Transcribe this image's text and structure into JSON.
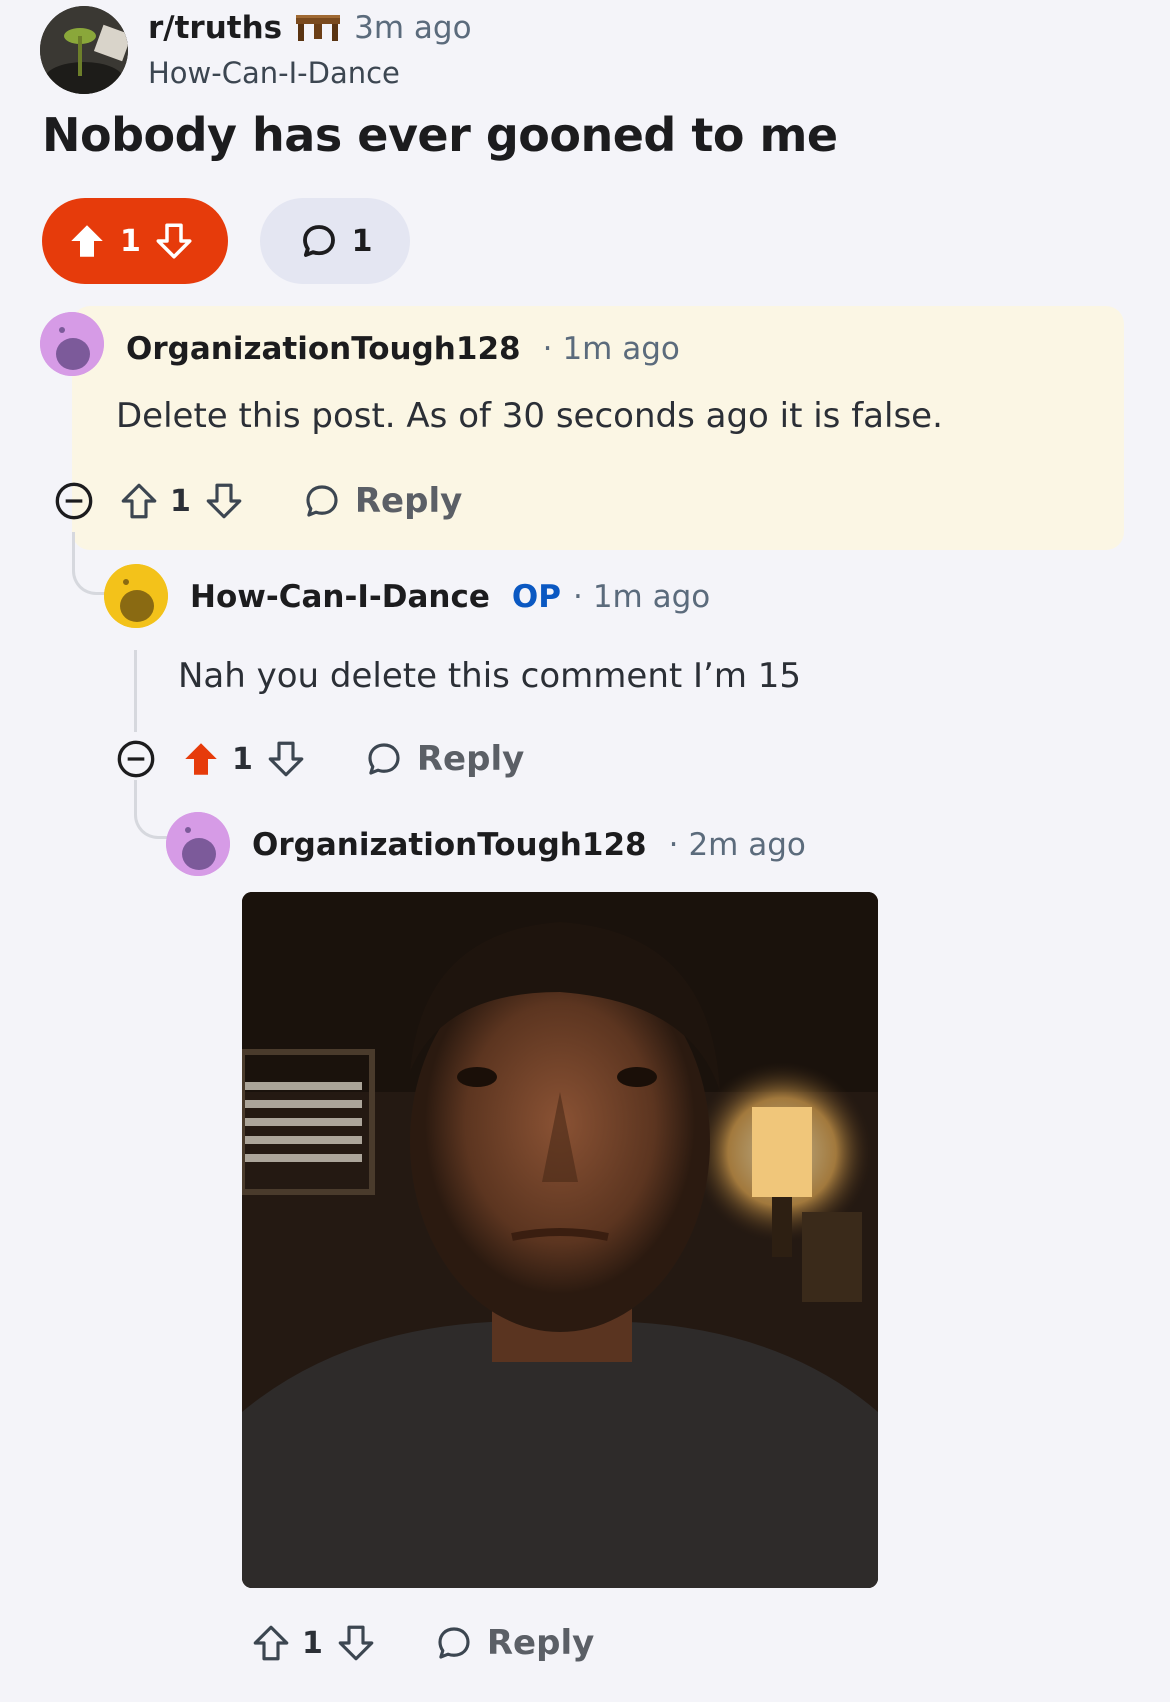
{
  "post": {
    "subreddit": "r/truths",
    "time": "3m ago",
    "author": "How-Can-I-Dance",
    "title": "Nobody has ever gooned to me",
    "vote_count": "1",
    "comment_count": "1",
    "upvote_color": "#e63b0b",
    "comment_pill_color": "#e4e6f2"
  },
  "comments": [
    {
      "author": "OrganizationTough128",
      "separator": "·",
      "time": "1m ago",
      "body": "Delete this post. As of 30 seconds ago it is false.",
      "votes": "1",
      "reply_label": "Reply",
      "highlight_color": "#fbf6e4",
      "avatar_color": "#d69be6"
    },
    {
      "author": "How-Can-I-Dance",
      "op_badge": "OP",
      "separator": "·",
      "time": "1m ago",
      "body": "Nah you delete this comment I’m 15",
      "votes": "1",
      "reply_label": "Reply",
      "avatar_color": "#f3c21a",
      "upvoted": true
    },
    {
      "author": "OrganizationTough128",
      "separator": "·",
      "time": "2m ago",
      "image": "photo-of-man-in-dark-room",
      "votes": "1",
      "reply_label": "Reply",
      "avatar_color": "#d69be6"
    }
  ],
  "colors": {
    "background": "#f4f4f9",
    "op_badge": "#0a58c2",
    "upvote_active": "#e63b0b"
  }
}
